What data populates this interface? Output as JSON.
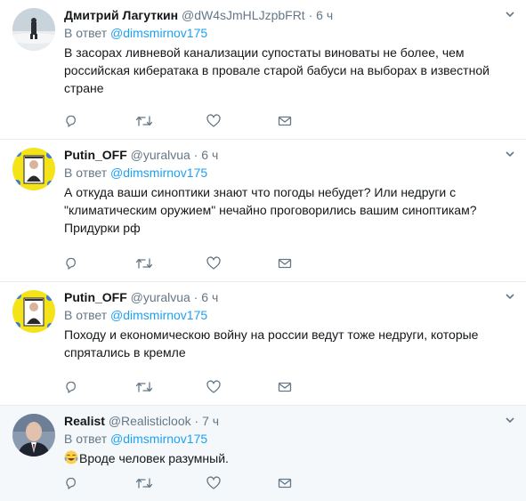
{
  "reply_prefix": "В ответ",
  "tweets": [
    {
      "fullname": "Дмитрий Лагуткин",
      "username": "@dW4sJmHLJzpbFRt",
      "time": "6 ч",
      "reply_to": "@dimsmirnov175",
      "text": "В засорах ливневой канализации  супостаты виноваты не более, чем российская кибератака в провале старой бабуси на выборах в известной стране"
    },
    {
      "fullname": "Putin_OFF",
      "username": "@yuralvua",
      "time": "6 ч",
      "reply_to": "@dimsmirnov175",
      "text": "А откуда ваши синоптики знают что погоды небудет? Или недруги с \"климатическим оружием\" нечайно проговорились вашим синоптикам? Придурки рф"
    },
    {
      "fullname": "Putin_OFF",
      "username": "@yuralvua",
      "time": "6 ч",
      "reply_to": "@dimsmirnov175",
      "text": "Походу и економическою войну на россии ведут тоже недруги, которые спрятались в кремле"
    },
    {
      "fullname": "Realist",
      "username": "@Realisticlook",
      "time": "7 ч",
      "reply_to": "@dimsmirnov175",
      "text": "Вроде человек разумный."
    }
  ],
  "icons": {
    "reply": "reply-icon",
    "retweet": "retweet-icon",
    "like": "heart-icon",
    "dm": "envelope-icon",
    "more": "chevron-down-icon"
  },
  "colors": {
    "link": "#1da1f2",
    "muted": "#657786",
    "text": "#14171a",
    "highlight_bg": "#f5f8fa"
  }
}
